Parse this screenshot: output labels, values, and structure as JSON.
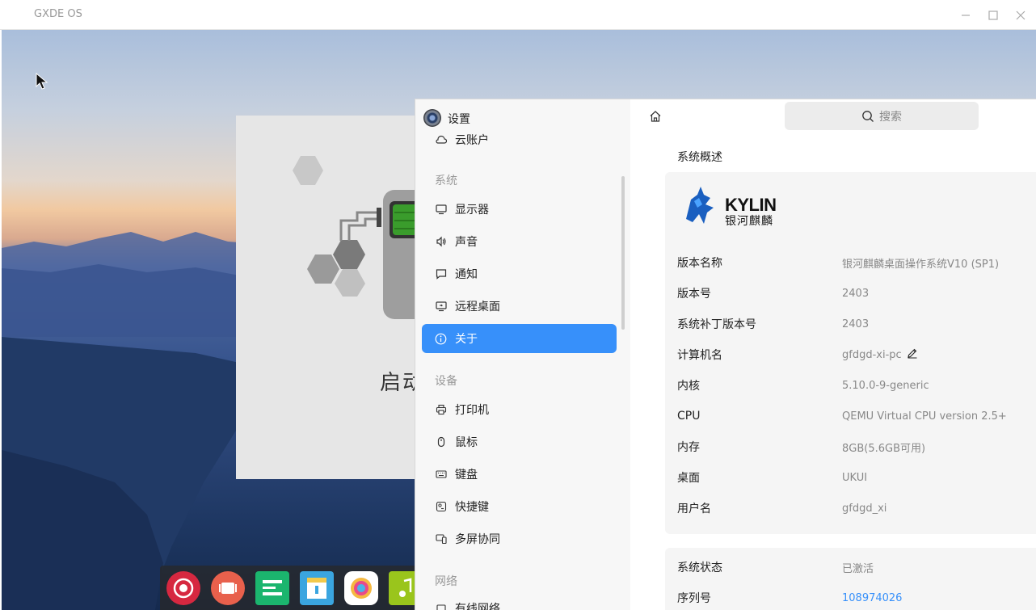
{
  "outer_window": {
    "title": "GXDE OS"
  },
  "splash": {
    "text": "启动"
  },
  "settings": {
    "title": "设置",
    "sidebar": {
      "partial_item": "云账户",
      "groups": [
        {
          "label": "系统",
          "items": [
            "显示器",
            "声音",
            "通知",
            "远程桌面",
            "关于"
          ]
        },
        {
          "label": "设备",
          "items": [
            "打印机",
            "鼠标",
            "键盘",
            "快捷键",
            "多屏协同"
          ]
        },
        {
          "label": "网络",
          "items": [
            "有线网络"
          ]
        }
      ],
      "active_item": "关于"
    },
    "search": {
      "placeholder": "搜索"
    },
    "overview": {
      "title": "系统概述",
      "logo_text": "KYLIN",
      "logo_subtext": "银河麒麟",
      "rows": [
        {
          "label": "版本名称",
          "value": "银河麒麟桌面操作系统V10 (SP1)"
        },
        {
          "label": "版本号",
          "value": "2403"
        },
        {
          "label": "系统补丁版本号",
          "value": "2403"
        },
        {
          "label": "计算机名",
          "value": "gfdgd-xi-pc"
        },
        {
          "label": "内核",
          "value": "5.10.0-9-generic"
        },
        {
          "label": "CPU",
          "value": "QEMU Virtual CPU version 2.5+"
        },
        {
          "label": "内存",
          "value": "8GB(5.6GB可用)"
        },
        {
          "label": "桌面",
          "value": "UKUI"
        },
        {
          "label": "用户名",
          "value": "gfdgd_xi"
        }
      ]
    },
    "status": {
      "rows": [
        {
          "label": "系统状态",
          "value": "已激活"
        },
        {
          "label": "序列号",
          "value": "108974026"
        }
      ]
    }
  },
  "colors": {
    "accent": "#3790fa",
    "sidebar_bg": "#f7f7f7",
    "card_bg": "#f5f5f5"
  }
}
